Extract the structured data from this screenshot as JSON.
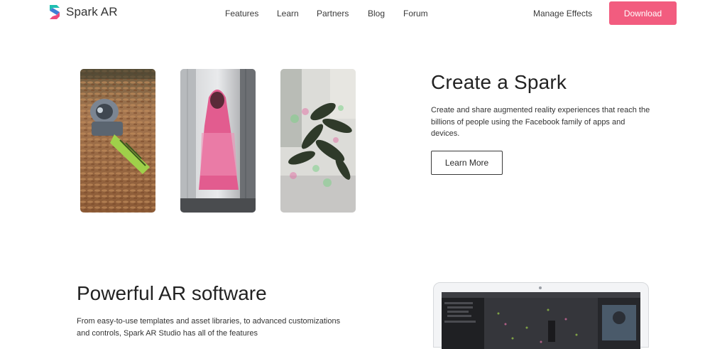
{
  "nav": {
    "logo_text": "Spark AR",
    "links": [
      "Features",
      "Learn",
      "Partners",
      "Blog",
      "Forum"
    ],
    "manage": "Manage Effects",
    "download": "Download"
  },
  "hero": {
    "title": "Create a Spark",
    "description": "Create and share augmented reality experiences that reach the billions of people using the Facebook family of apps and devices.",
    "cta": "Learn More"
  },
  "section2": {
    "title": "Powerful AR software",
    "description": "From easy-to-use templates and asset libraries, to advanced customizations and controls, Spark AR Studio has all of the features"
  },
  "colors": {
    "brand_pink": "#f25c7f",
    "logo_teal": "#1fbfb0",
    "logo_pink": "#ee4a7d"
  }
}
